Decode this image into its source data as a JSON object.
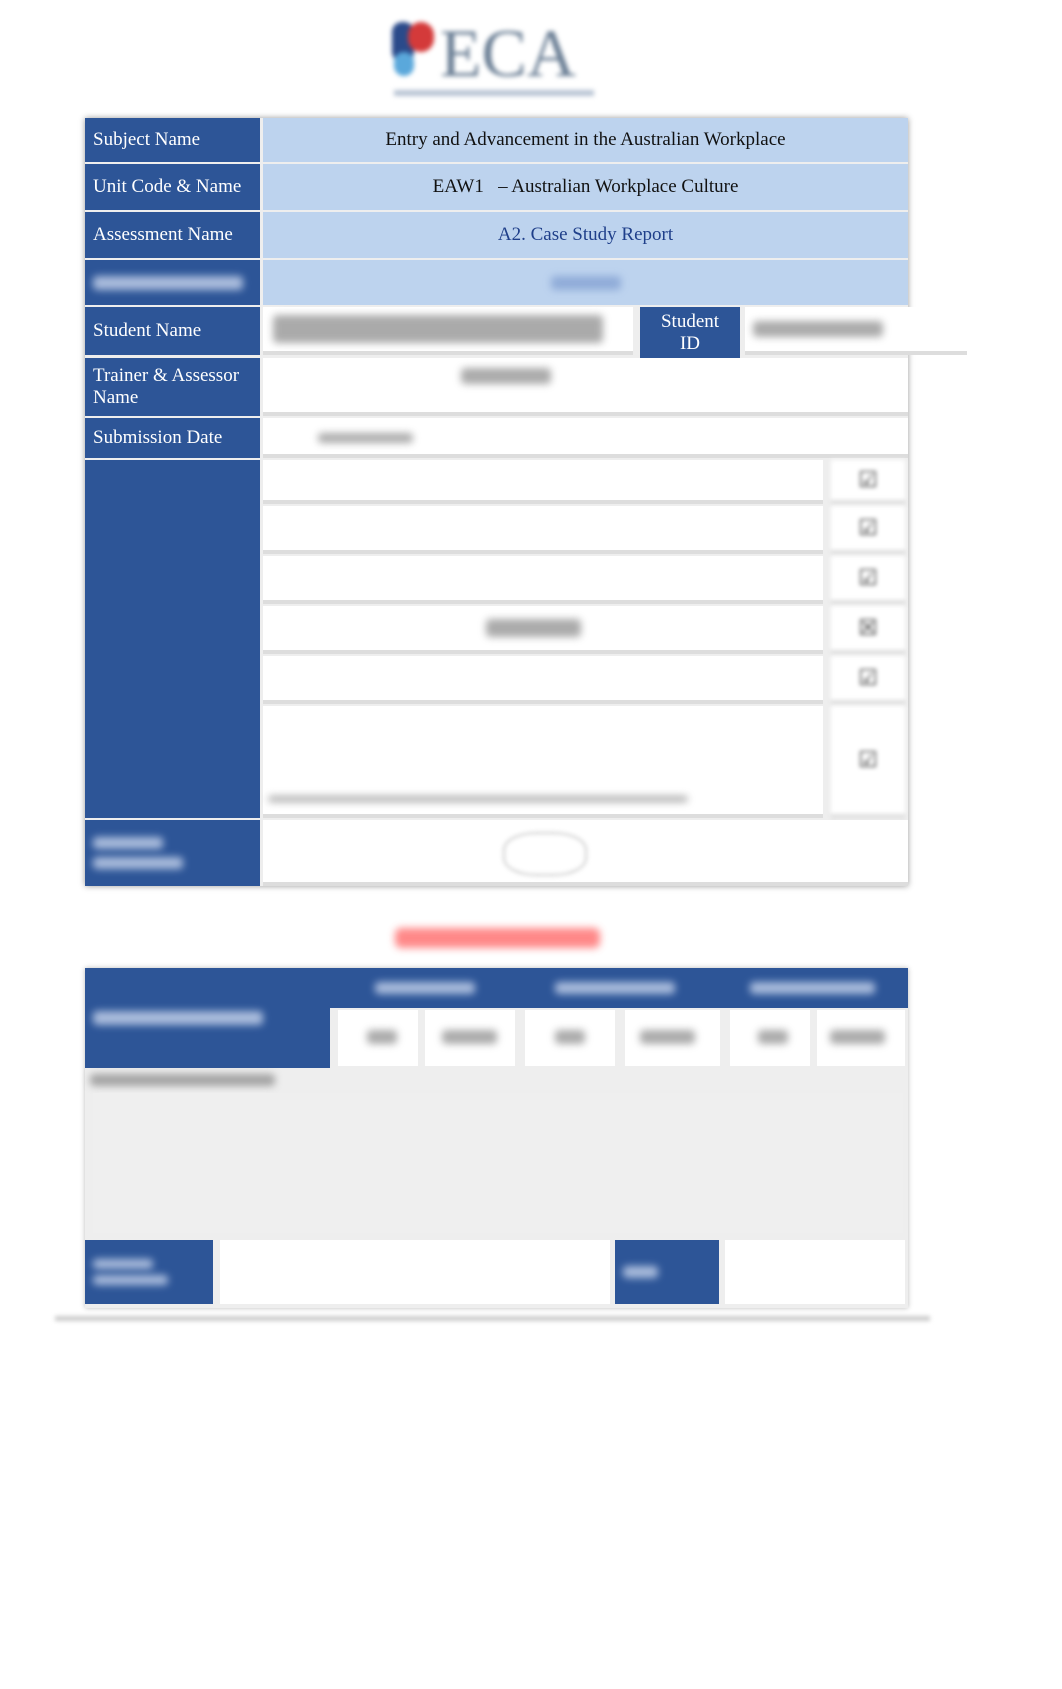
{
  "header": {
    "logo_text": "ECA"
  },
  "cover_table": {
    "rows": [
      {
        "label": "Subject Name",
        "value": "Entry and Advancement in the Australian Workplace"
      },
      {
        "label": "Unit Code & Name",
        "value": "EAW1   – Australian Workplace Culture"
      },
      {
        "label": "Assessment Name",
        "value": "A2. Case Study Report"
      }
    ],
    "student_name_label": "Student Name",
    "student_id_label": "Student ID",
    "trainer_label": "Trainer & Assessor Name",
    "submission_label": "Submission Date"
  },
  "colors": {
    "label_bg": "#2d5597",
    "value_bg": "#bdd3ee",
    "assessment_name_text": "#1f3f8a",
    "warning_title": "#ff4b4b"
  }
}
